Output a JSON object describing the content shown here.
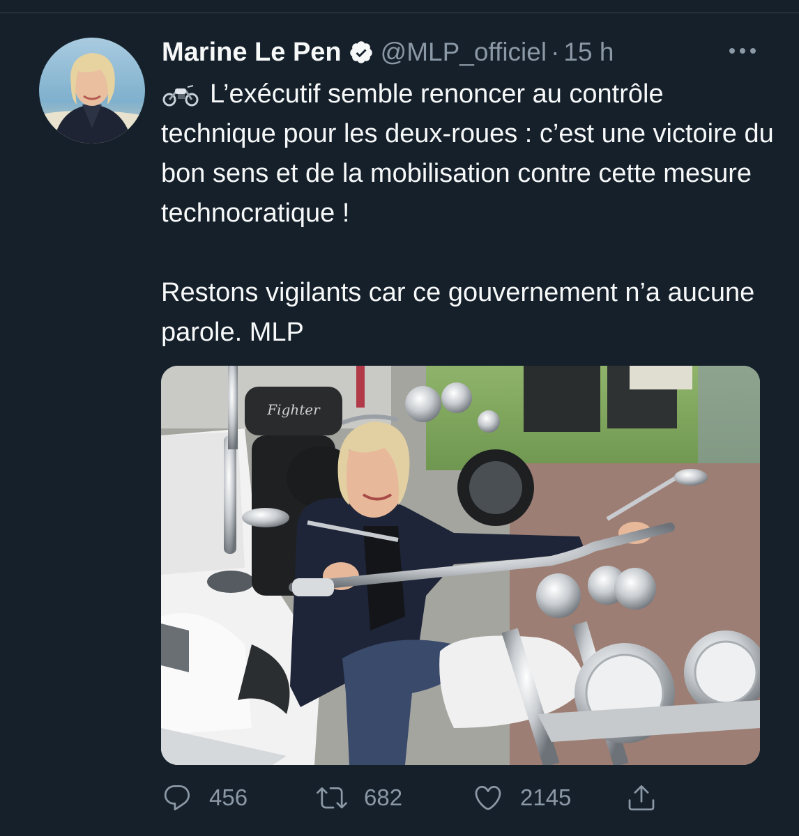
{
  "tweet": {
    "author": {
      "display_name": "Marine Le Pen",
      "handle": "@MLP_officiel",
      "verified": true,
      "avatar_icon": "avatar-photo"
    },
    "separator": "·",
    "timestamp": "15 h",
    "more_icon": "more-horizontal-icon",
    "emoji": "motorcycle",
    "text_line1": "L’exécutif semble renoncer au contrôle technique pour les deux-roues : c’est une victoire du bon sens et de la mobilisation contre cette mesure technocratique !",
    "text_line2": "Restons vigilants car ce gouvernement n’a aucune parole. MLP",
    "media": {
      "type": "photo",
      "seat_badge": "Fighter"
    },
    "actions": {
      "reply_count": "456",
      "retweet_count": "682",
      "like_count": "2145"
    }
  },
  "colors": {
    "background": "#15202b",
    "text_primary": "#f7f9f9",
    "text_secondary": "#8b98a5",
    "divider": "#38444d"
  }
}
